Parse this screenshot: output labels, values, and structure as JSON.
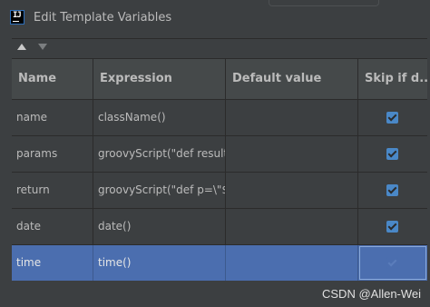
{
  "window": {
    "title": "Edit Template Variables",
    "app_icon_text": "IJ"
  },
  "toolbar": {
    "move_up": "move-up",
    "move_down": "move-down"
  },
  "table": {
    "headers": [
      "Name",
      "Expression",
      "Default value",
      "Skip if d..."
    ],
    "rows": [
      {
        "name": "name",
        "expression": "className()",
        "default": "",
        "skip": true,
        "selected": false
      },
      {
        "name": "params",
        "expression": "groovyScript(\"def result...",
        "default": "",
        "skip": true,
        "selected": false
      },
      {
        "name": "return",
        "expression": "groovyScript(\"def p=\\\"$...",
        "default": "",
        "skip": true,
        "selected": false
      },
      {
        "name": "date",
        "expression": "date()",
        "default": "",
        "skip": true,
        "selected": false
      },
      {
        "name": "time",
        "expression": "time()",
        "default": "",
        "skip": true,
        "selected": true
      }
    ]
  },
  "watermark": "CSDN @Allen-Wei",
  "colors": {
    "background": "#3c3f41",
    "header": "#45494a",
    "selection": "#4b6eaf",
    "checkbox": "#4a88c7"
  }
}
